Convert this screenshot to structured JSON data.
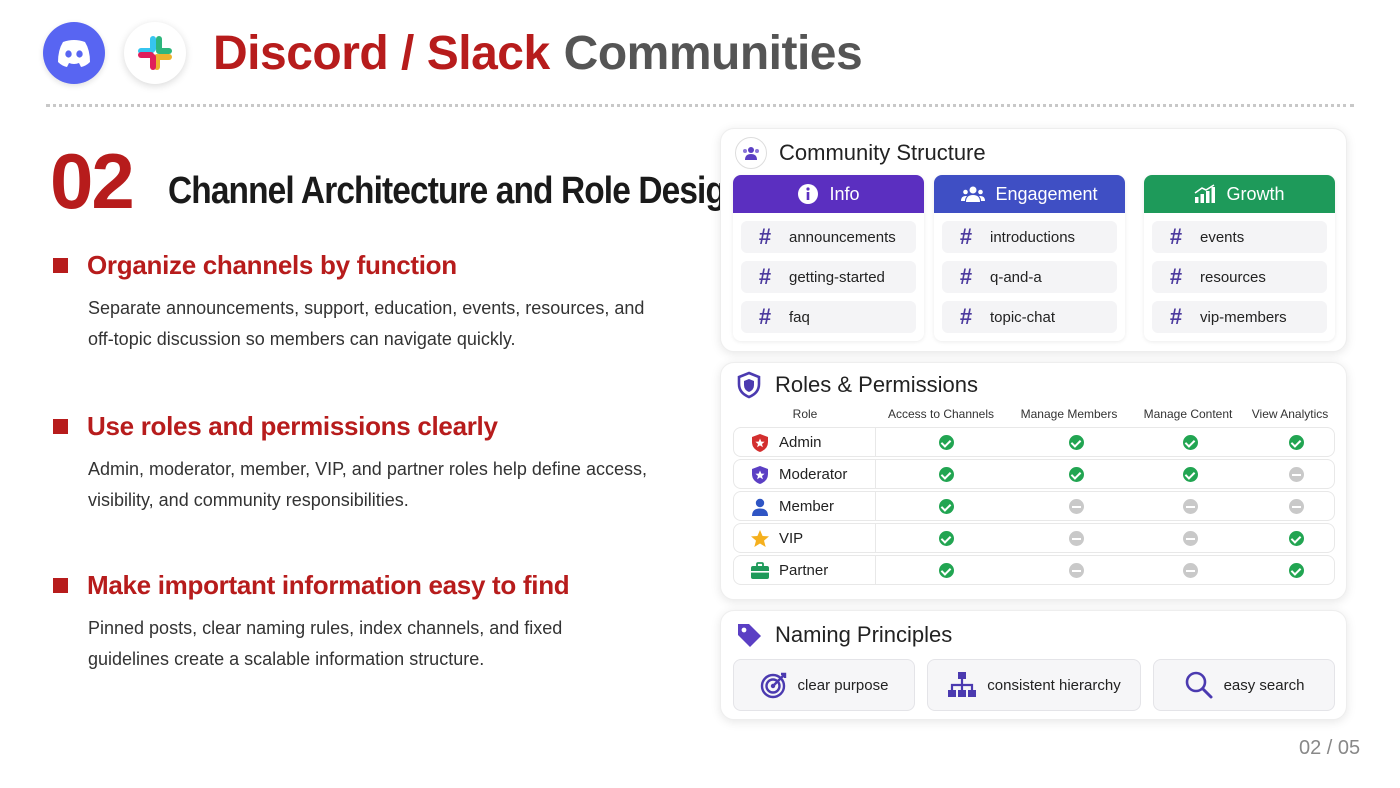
{
  "header": {
    "title_main": "Discord / Slack",
    "title_sub": "Communities"
  },
  "section": {
    "number": "02",
    "title": "Channel Architecture and Role Design"
  },
  "points": [
    {
      "heading": "Organize channels by function",
      "body": "Separate announcements, support, education, events, resources, and off-topic discussion so members can navigate quickly."
    },
    {
      "heading": "Use roles and permissions clearly",
      "body": "Admin, moderator, member, VIP, and partner roles help define access, visibility, and community responsibilities."
    },
    {
      "heading": "Make important information easy to find",
      "body": "Pinned posts, clear naming rules, index channels, and fixed guidelines create a scalable information structure."
    }
  ],
  "structure": {
    "title": "Community Structure",
    "columns": [
      {
        "label": "Info",
        "color": "#5B2FC0",
        "channels": [
          "announcements",
          "getting-started",
          "faq"
        ]
      },
      {
        "label": "Engagement",
        "color": "#3F4FC4",
        "channels": [
          "introductions",
          "q-and-a",
          "topic-chat"
        ]
      },
      {
        "label": "Growth",
        "color": "#1E9A5A",
        "channels": [
          "events",
          "resources",
          "vip-members"
        ]
      }
    ],
    "hash": "#"
  },
  "roles": {
    "title": "Roles & Permissions",
    "headers": [
      "Role",
      "Access to Channels",
      "Manage Members",
      "Manage Content",
      "View Analytics"
    ],
    "rows": [
      {
        "name": "Admin",
        "icon": "shield-star-icon",
        "perms": [
          true,
          true,
          true,
          true
        ]
      },
      {
        "name": "Moderator",
        "icon": "badge-star-icon",
        "perms": [
          true,
          true,
          true,
          false
        ]
      },
      {
        "name": "Member",
        "icon": "person-icon",
        "perms": [
          true,
          false,
          false,
          false
        ]
      },
      {
        "name": "VIP",
        "icon": "star-icon",
        "perms": [
          true,
          false,
          false,
          true
        ]
      },
      {
        "name": "Partner",
        "icon": "briefcase-icon",
        "perms": [
          true,
          false,
          false,
          true
        ]
      }
    ]
  },
  "naming": {
    "title": "Naming Principles",
    "chips": [
      "clear purpose",
      "consistent hierarchy",
      "easy search"
    ]
  },
  "pager": "02 / 05",
  "colors": {
    "accent_red": "#B71C1C",
    "discord": "#5865F2",
    "ok": "#22A552",
    "no": "#C9C9C9",
    "purple": "#4B3A9E"
  }
}
